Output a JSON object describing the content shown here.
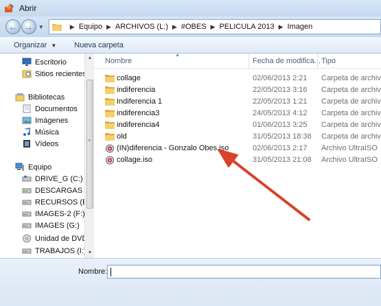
{
  "window": {
    "title": "Abrir"
  },
  "address": {
    "crumbs": [
      "Equipo",
      "ARCHIVOS (L:)",
      "#OBES",
      "PELICULA 2013",
      "Imagen"
    ]
  },
  "toolbar": {
    "organize_label": "Organizar",
    "new_folder_label": "Nueva carpeta"
  },
  "nav": {
    "items": [
      {
        "label": "Escritorio",
        "icon": "desktop-icon"
      },
      {
        "label": "Sitios recientes",
        "icon": "recent-places-icon"
      },
      {
        "label": "Bibliotecas",
        "icon": "libraries-icon"
      },
      {
        "label": "Documentos",
        "icon": "documents-icon"
      },
      {
        "label": "Imágenes",
        "icon": "pictures-icon"
      },
      {
        "label": "Música",
        "icon": "music-icon"
      },
      {
        "label": "Vídeos",
        "icon": "videos-icon"
      },
      {
        "label": "Equipo",
        "icon": "computer-icon"
      },
      {
        "label": "DRIVE_G (C:)",
        "icon": "drive-icon"
      },
      {
        "label": "DESCARGAS (D:)",
        "icon": "drive-icon"
      },
      {
        "label": "RECURSOS (E:)",
        "icon": "drive-icon"
      },
      {
        "label": "IMAGES-2 (F:)",
        "icon": "drive-icon"
      },
      {
        "label": "IMAGES (G:)",
        "icon": "drive-icon"
      },
      {
        "label": "Unidad de DVD R",
        "icon": "dvd-icon"
      },
      {
        "label": "TRABAJOS (I:)",
        "icon": "drive-icon"
      }
    ]
  },
  "columns": {
    "name": "Nombre",
    "date": "Fecha de modifica...",
    "type": "Tipo"
  },
  "files": [
    {
      "name": "collage",
      "date": "02/06/2013 2:21",
      "type": "Carpeta de archivos",
      "icon": "folder-icon"
    },
    {
      "name": "indiferencia",
      "date": "22/05/2013 3:16",
      "type": "Carpeta de archivos",
      "icon": "folder-icon"
    },
    {
      "name": "Indiferencia 1",
      "date": "22/05/2013 1:21",
      "type": "Carpeta de archivos",
      "icon": "folder-icon"
    },
    {
      "name": "indiferencia3",
      "date": "24/05/2013 4:12",
      "type": "Carpeta de archivos",
      "icon": "folder-icon"
    },
    {
      "name": "indiferencia4",
      "date": "01/06/2013 3:25",
      "type": "Carpeta de archivos",
      "icon": "folder-icon"
    },
    {
      "name": "old",
      "date": "31/05/2013 18:38",
      "type": "Carpeta de archivos",
      "icon": "folder-icon"
    },
    {
      "name": "(IN)diferencia - Gonzalo Obes.iso",
      "date": "02/06/2013 2:17",
      "type": "Archivo UltraISO",
      "icon": "iso-file-icon"
    },
    {
      "name": "collage.iso",
      "date": "31/05/2013 21:08",
      "type": "Archivo UltraISO",
      "icon": "iso-file-icon"
    }
  ],
  "filename": {
    "label": "Nombre:",
    "value": ""
  },
  "colors": {
    "annotation_arrow": "#d9412a",
    "folder": "#e8b84a"
  }
}
